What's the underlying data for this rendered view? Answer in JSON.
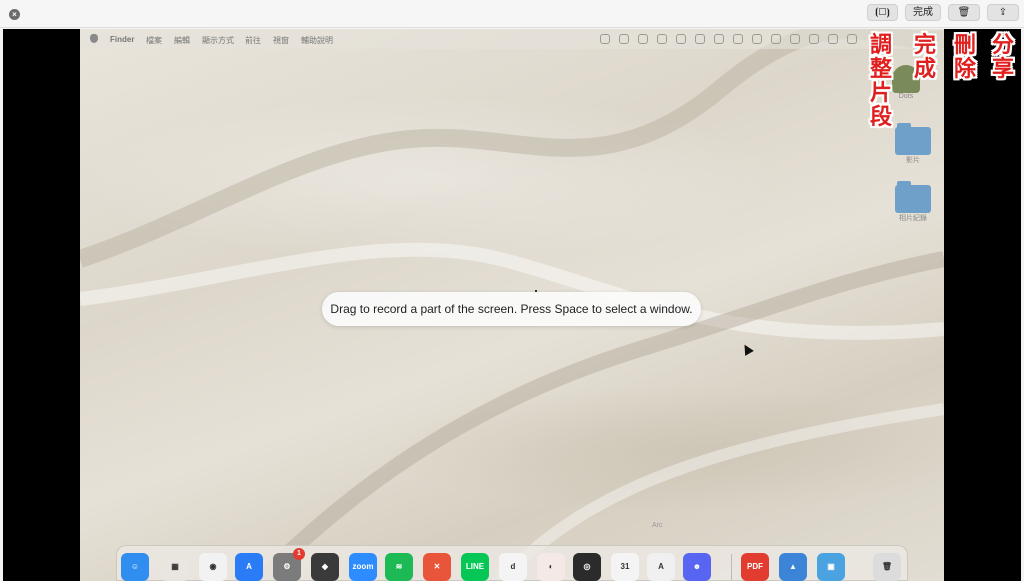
{
  "toolbar": {
    "trim_icon": "trim-icon",
    "done_label": "完成",
    "trash_icon": "trash-icon",
    "share_icon": "share-icon"
  },
  "annotations": {
    "trim": "調整片段",
    "done": "完成",
    "delete": "刪除",
    "share": "分享"
  },
  "desktop": {
    "menubar": {
      "app": "Finder",
      "items": [
        "檔案",
        "編輯",
        "顯示方式",
        "前往",
        "視窗",
        "輔助說明"
      ]
    },
    "icons": [
      {
        "label": "Dots"
      },
      {
        "label": "影片"
      },
      {
        "label": "相片紀錄"
      }
    ]
  },
  "hint_text": "Drag to record a part of the screen. Press Space to select a window.",
  "dock_tooltip": "Arc",
  "dock": {
    "apps": [
      {
        "name": "Finder",
        "color": "#2f8ef0",
        "glyph": "☺"
      },
      {
        "name": "Launchpad",
        "color": "#e9e6e0",
        "glyph": "▦"
      },
      {
        "name": "Chrome",
        "color": "#f2f2f2",
        "glyph": "◉"
      },
      {
        "name": "App Store",
        "color": "#2a7cf6",
        "glyph": "A"
      },
      {
        "name": "System Settings",
        "color": "#7b7b7b",
        "glyph": "⚙",
        "badge": "1"
      },
      {
        "name": "Notion-like",
        "color": "#3a3a3a",
        "glyph": "◆"
      },
      {
        "name": "Zoom",
        "color": "#2d8cff",
        "glyph": "zoom"
      },
      {
        "name": "Spotify",
        "color": "#1db954",
        "glyph": "≋"
      },
      {
        "name": "Xmind",
        "color": "#e8553b",
        "glyph": "✕"
      },
      {
        "name": "LINE",
        "color": "#06c755",
        "glyph": "LINE"
      },
      {
        "name": "Dictionary",
        "color": "#f4f4f4",
        "glyph": "d"
      },
      {
        "name": "Arc",
        "color": "#f5e9e8",
        "glyph": "◐"
      },
      {
        "name": "OBS",
        "color": "#2b2b2b",
        "glyph": "◎"
      },
      {
        "name": "Calendar",
        "color": "#f4f4f4",
        "glyph": "31"
      },
      {
        "name": "Astro",
        "color": "#f0f0f0",
        "glyph": "A"
      },
      {
        "name": "Discord",
        "color": "#5865f2",
        "glyph": "☻"
      },
      {
        "name": "PDF Expert",
        "color": "#e23b2f",
        "glyph": "PDF"
      },
      {
        "name": "Preview",
        "color": "#3b84d8",
        "glyph": "▲"
      },
      {
        "name": "Photos",
        "color": "#4aa3e0",
        "glyph": "▣"
      },
      {
        "name": "Trash",
        "color": "#dcdcdc",
        "glyph": "🗑"
      }
    ]
  }
}
